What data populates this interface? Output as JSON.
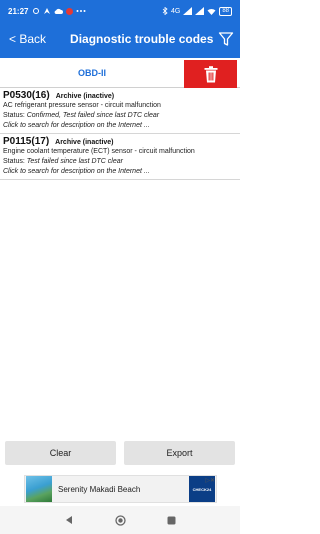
{
  "status_bar": {
    "time": "21:27",
    "network": "4G",
    "battery": "88"
  },
  "app_bar": {
    "back_label": "< Back",
    "title": "Diagnostic trouble codes"
  },
  "tab": {
    "label": "OBD-II"
  },
  "dtc_list": [
    {
      "code": "P0530(16)",
      "state": "Archive (inactive)",
      "description": "AC refrigerant pressure sensor - circuit malfunction",
      "status_label": "Status: ",
      "status_value": "Confirmed, Test failed since last DTC clear",
      "search_hint": "Click to search for description on the Internet ..."
    },
    {
      "code": "P0115(17)",
      "state": "Archive (inactive)",
      "description": "Engine coolant temperature (ECT) sensor - circuit malfunction",
      "status_label": "Status: ",
      "status_value": "Test failed since last DTC clear",
      "search_hint": "Click to search for description on the Internet ..."
    }
  ],
  "buttons": {
    "clear": "Clear",
    "export": "Export"
  },
  "ad": {
    "text": "Serenity Makadi Beach",
    "logo_text": "CHECK24"
  },
  "colors": {
    "primary": "#1e6fd9",
    "delete": "#e02020",
    "button_bg": "#e3e3e3"
  },
  "icons": {
    "filter": "filter-icon",
    "delete": "trash-icon",
    "nav_back": "nav-back-icon",
    "nav_home": "nav-home-icon",
    "nav_recents": "nav-recents-icon"
  }
}
